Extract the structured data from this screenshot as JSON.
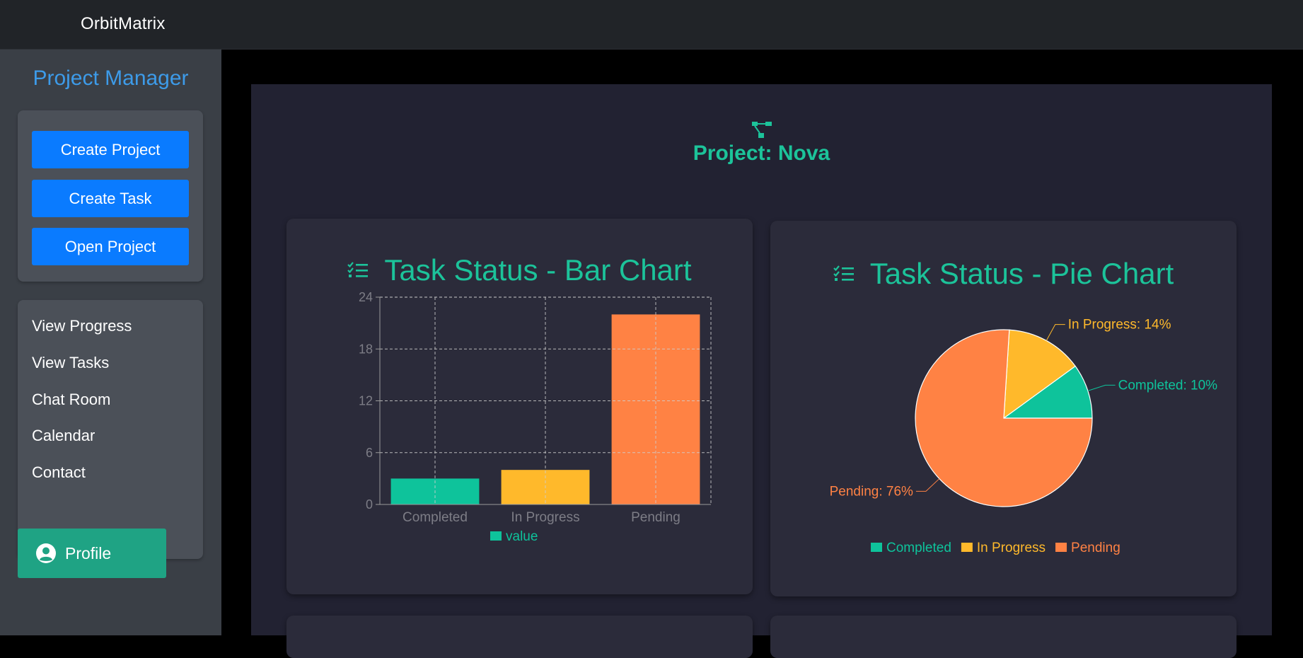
{
  "app": {
    "brand": "OrbitMatrix"
  },
  "sidebar": {
    "title": "Project Manager",
    "actions": [
      {
        "label": "Create Project"
      },
      {
        "label": "Create Task"
      },
      {
        "label": "Open Project"
      }
    ],
    "nav": [
      {
        "label": "View Progress"
      },
      {
        "label": "View Tasks"
      },
      {
        "label": "Chat Room"
      },
      {
        "label": "Calendar"
      },
      {
        "label": "Contact"
      }
    ],
    "profile": {
      "label": "Profile",
      "icon": "user-circle-icon"
    }
  },
  "project": {
    "title": "Project: Nova",
    "icon": "project-diagram-icon"
  },
  "colors": {
    "accent": "#1cc39a",
    "completed": "#0ec39b",
    "in_progress": "#ffb92b",
    "pending": "#ff8244",
    "button_blue": "#0a7bff",
    "sidebar_title": "#3d9be9"
  },
  "chart_data": [
    {
      "type": "bar",
      "title": "Task Status - Bar Chart",
      "categories": [
        "Completed",
        "In Progress",
        "Pending"
      ],
      "series": [
        {
          "name": "value",
          "values": [
            3,
            4,
            22
          ]
        }
      ],
      "bar_colors": [
        "#0ec39b",
        "#ffb92b",
        "#ff8244"
      ],
      "ylim": [
        0,
        24
      ],
      "yticks": [
        0,
        6,
        12,
        18,
        24
      ],
      "grid": true,
      "legend": "bottom"
    },
    {
      "type": "pie",
      "title": "Task Status - Pie Chart",
      "slices": [
        {
          "name": "Completed",
          "value": 10,
          "label": "Completed: 10%",
          "color": "#0ec39b"
        },
        {
          "name": "In Progress",
          "value": 14,
          "label": "In Progress: 14%",
          "color": "#ffb92b"
        },
        {
          "name": "Pending",
          "value": 76,
          "label": "Pending: 76%",
          "color": "#ff8244"
        }
      ],
      "legend": "bottom"
    }
  ]
}
